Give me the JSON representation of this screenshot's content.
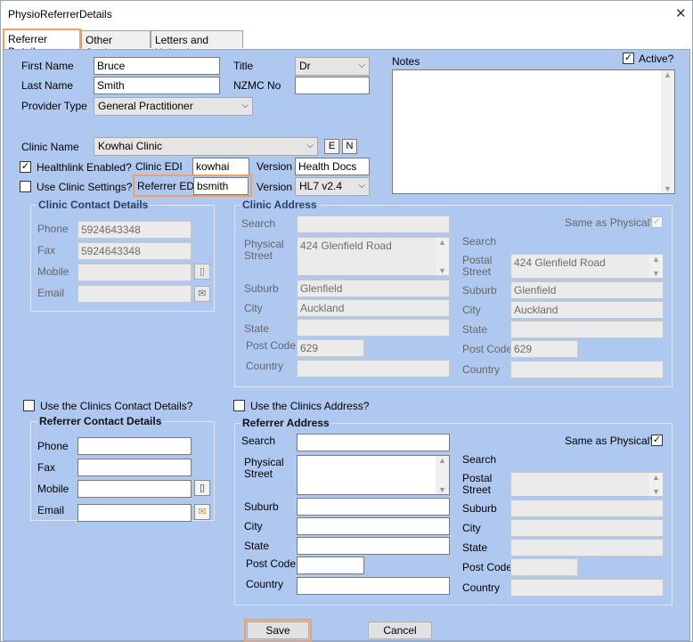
{
  "window": {
    "title": "PhysioReferrerDetails",
    "close_glyph": "✕"
  },
  "tabs": [
    {
      "label": "Referrer Details",
      "active": true
    },
    {
      "label": "Other Settings",
      "active": false
    },
    {
      "label": "Letters and Uploads",
      "active": false
    }
  ],
  "referrer": {
    "first_name_label": "First Name",
    "first_name": "Bruce",
    "last_name_label": "Last Name",
    "last_name": "Smith",
    "title_label": "Title",
    "title": "Dr",
    "nzmc_label": "NZMC No",
    "nzmc": "",
    "provider_type_label": "Provider Type",
    "provider_type": "General Practitioner"
  },
  "notes": {
    "label": "Notes",
    "value": "",
    "active_label": "Active?",
    "active_checked": true
  },
  "clinic": {
    "name_label": "Clinic Name",
    "name": "Kowhai Clinic",
    "edit_btn": "E",
    "new_btn": "N",
    "healthlink_label": "Healthlink Enabled?",
    "healthlink_checked": true,
    "use_clinic_settings_label": "Use Clinic Settings?",
    "use_clinic_settings_checked": false,
    "clinic_edi_label": "Clinic EDI",
    "clinic_edi": "kowhai",
    "version_label": "Version",
    "version_clinic": "Health Docs",
    "referrer_edi_label": "Referrer EDI",
    "referrer_edi": "bsmith",
    "version_referrer": "HL7 v2.4"
  },
  "clinic_contact": {
    "title": "Clinic Contact Details",
    "phone_label": "Phone",
    "phone": "5924643348",
    "fax_label": "Fax",
    "fax": "5924643348",
    "mobile_label": "Mobile",
    "mobile": "",
    "email_label": "Email",
    "email": ""
  },
  "clinic_address": {
    "title": "Clinic Address",
    "search_label": "Search",
    "same_as_physical_label": "Same as Physical?",
    "same_as_physical_checked": true,
    "physical_street_label_1": "Physical",
    "physical_street_label_2": "Street",
    "physical_street": "424 Glenfield Road",
    "suburb_label": "Suburb",
    "suburb": "Glenfield",
    "city_label": "City",
    "city": "Auckland",
    "state_label": "State",
    "state": "",
    "post_code_label": "Post Code",
    "post_code": "629",
    "country_label": "Country",
    "country": "",
    "postal_search_label": "Search",
    "postal_street_label_1": "Postal",
    "postal_street_label_2": "Street",
    "postal_street": "424 Glenfield Road",
    "postal_suburb_label": "Suburb",
    "postal_suburb": "Glenfield",
    "postal_city_label": "City",
    "postal_city": "Auckland",
    "postal_state_label": "State",
    "postal_state": "",
    "postal_post_code_label": "Post Code",
    "postal_post_code": "629",
    "postal_country_label": "Country",
    "postal_country": ""
  },
  "referrer_contact": {
    "use_clinic_contact_label": "Use the Clinics Contact Details?",
    "use_clinic_contact_checked": false,
    "title": "Referrer Contact Details",
    "phone_label": "Phone",
    "phone": "",
    "fax_label": "Fax",
    "fax": "",
    "mobile_label": "Mobile",
    "mobile": "",
    "email_label": "Email",
    "email": ""
  },
  "referrer_address": {
    "use_clinic_address_label": "Use the Clinics Address?",
    "use_clinic_address_checked": false,
    "title": "Referrer Address",
    "search_label": "Search",
    "same_as_physical_label": "Same as Physical?",
    "same_as_physical_checked": true,
    "physical_street_label_1": "Physical",
    "physical_street_label_2": "Street",
    "physical_street": "",
    "suburb_label": "Suburb",
    "suburb": "",
    "city_label": "City",
    "city": "",
    "state_label": "State",
    "state": "",
    "post_code_label": "Post Code",
    "post_code": "",
    "country_label": "Country",
    "country": "",
    "postal_search_label": "Search",
    "postal_street_label_1": "Postal",
    "postal_street_label_2": "Street",
    "postal_street": "",
    "postal_suburb_label": "Suburb",
    "postal_suburb": "",
    "postal_city_label": "City",
    "postal_city": "",
    "postal_state_label": "State",
    "postal_state": "",
    "postal_post_code_label": "Post Code",
    "postal_post_code": "",
    "postal_country_label": "Country",
    "postal_country": ""
  },
  "actions": {
    "save": "Save",
    "cancel": "Cancel"
  },
  "glyphs": {
    "check": "✓",
    "dropdown": "⌵",
    "scroll_up": "▲",
    "scroll_down": "▼",
    "mobile": "▯",
    "email": "✉"
  },
  "colors": {
    "panel": "#afc8f0",
    "highlight": "#f0a060"
  }
}
